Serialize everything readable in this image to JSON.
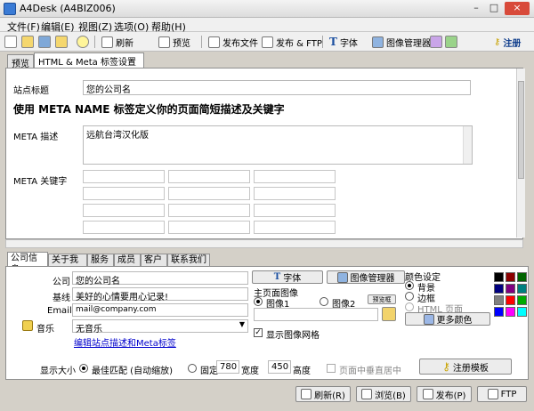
{
  "window": {
    "title": "A4Desk (A4BIZ006)",
    "min": "–",
    "max": "□",
    "close": "×"
  },
  "menu": [
    "文件(F)",
    "编辑(E)",
    "视图(Z)",
    "选项(O)",
    "帮助(H)"
  ],
  "toolbar": {
    "refresh": "刷新",
    "preview": "预览",
    "publish_file": "发布文件",
    "publish_ftp": "发布 & FTP",
    "font": "字体",
    "image_manager": "图像管理器",
    "register": "注册"
  },
  "top_tabs": [
    "预览",
    "HTML & Meta 标签设置"
  ],
  "meta": {
    "site_title_label": "站点标题",
    "site_title_value": "您的公司名",
    "heading": "使用 META NAME 标签定义你的页面简短描述及关键字",
    "desc_label": "META 描述",
    "desc_value": "远航台湾汉化版",
    "keywords_label": "META 关键字"
  },
  "bottom_tabs": [
    "公司信息",
    "关于我们",
    "服务",
    "成员",
    "客户",
    "联系我们"
  ],
  "company": {
    "company_label": "公司",
    "company_value": "您的公司名",
    "slogan_label": "基线",
    "slogan_value": "美好的心情要用心记录!",
    "email_label": "Email",
    "email_value": "mail@company.com",
    "music_label": "音乐",
    "music_value": "无音乐",
    "edit_link": "编辑站点描述和Meta标签"
  },
  "center": {
    "font_btn": "字体",
    "image_mgr_btn": "图像管理器",
    "homepage_image": "主页面图像",
    "image1": "图像1",
    "image2": "图像2",
    "browse": "预览框",
    "show_grid": "显示图像网格"
  },
  "colors_panel": {
    "title": "颜色设定",
    "bg": "背景",
    "border": "边框",
    "html_page": "HTML 页面",
    "more": "更多颜色",
    "swatches": [
      "#000000",
      "#8b0000",
      "#006400",
      "#000080",
      "#800080",
      "#008080",
      "#808080",
      "#ff0000",
      "#00aa00",
      "#0000ff",
      "#ff00ff",
      "#00ffff"
    ]
  },
  "display": {
    "size_label": "显示大小",
    "best_fit": "最佳匹配 (自动缩放)",
    "fixed": "固定",
    "width_value": "780",
    "width_label": "宽度",
    "height_value": "450",
    "height_label": "高度",
    "vcenter": "页面中垂直居中",
    "register_template": "注册模板"
  },
  "bottombar": {
    "refresh": "刷新(R)",
    "preview": "浏览(B)",
    "publish": "发布(P)",
    "ftp": "FTP"
  }
}
